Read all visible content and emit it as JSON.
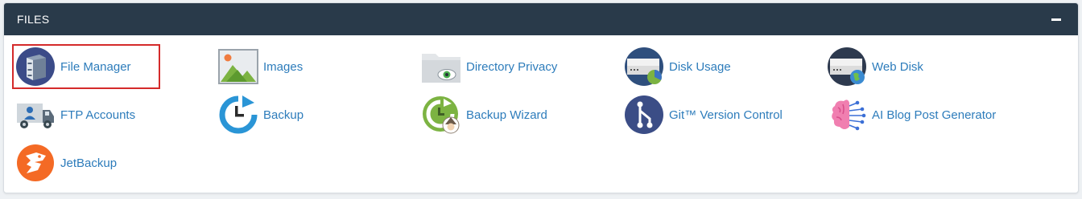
{
  "section": {
    "title": "FILES",
    "collapse_icon": "minus-icon"
  },
  "items": [
    {
      "label": "File Manager",
      "icon": "file-cabinet-icon",
      "active": true
    },
    {
      "label": "Images",
      "icon": "image-landscape-icon"
    },
    {
      "label": "Directory Privacy",
      "icon": "folder-eye-icon"
    },
    {
      "label": "Disk Usage",
      "icon": "server-pie-icon"
    },
    {
      "label": "Web Disk",
      "icon": "server-globe-icon"
    },
    {
      "label": "FTP Accounts",
      "icon": "truck-user-icon"
    },
    {
      "label": "Backup",
      "icon": "clock-refresh-icon"
    },
    {
      "label": "Backup Wizard",
      "icon": "wizard-refresh-icon"
    },
    {
      "label": "Git™ Version Control",
      "icon": "git-branch-icon"
    },
    {
      "label": "AI Blog Post Generator",
      "icon": "ai-brain-icon"
    },
    {
      "label": "JetBackup",
      "icon": "jetbackup-logo-icon"
    }
  ],
  "colors": {
    "header_bg": "#293a4a",
    "link": "#2d7cbb",
    "active_border": "#d42a2a"
  }
}
